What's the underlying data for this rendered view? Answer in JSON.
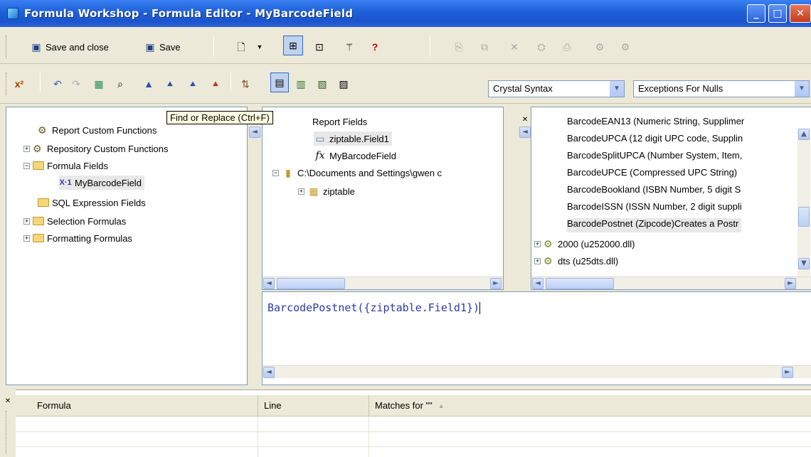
{
  "window": {
    "title": "Formula Workshop - Formula Editor - MyBarcodeField"
  },
  "toolbar1": {
    "save_and_close": "Save and close",
    "save": "Save"
  },
  "toolbar2": {
    "syntax_selected": "Crystal Syntax",
    "nulls_selected": "Exceptions For Nulls"
  },
  "tooltip": "Find or Replace (Ctrl+F)",
  "workshop_tree": {
    "items": [
      {
        "label": "Report Custom Functions"
      },
      {
        "label": "Repository Custom Functions"
      },
      {
        "label": "Formula Fields"
      },
      {
        "label": "MyBarcodeField"
      },
      {
        "label": "SQL Expression Fields"
      },
      {
        "label": "Selection Formulas"
      },
      {
        "label": "Formatting Formulas"
      }
    ]
  },
  "field_tree": {
    "items": [
      {
        "label": "Report Fields"
      },
      {
        "label": "ziptable.Field1"
      },
      {
        "label": "MyBarcodeField"
      },
      {
        "label": "C:\\Documents and Settings\\gwen c"
      },
      {
        "label": "ziptable"
      }
    ]
  },
  "function_tree": {
    "items": [
      {
        "label": "BarcodeEAN13 (Numeric String, Supplimer"
      },
      {
        "label": "BarcodeUPCA (12 digit UPC code, Supplin"
      },
      {
        "label": "BarcodeSplitUPCA (Number System, Item,"
      },
      {
        "label": "BarcodeUPCE (Compressed UPC String)"
      },
      {
        "label": "BarcodeBookland (ISBN Number, 5 digit S"
      },
      {
        "label": "BarcodeISSN (ISSN Number, 2 digit suppli"
      },
      {
        "label": "BarcodePostnet (Zipcode)Creates a Postr"
      },
      {
        "label": "2000 (u252000.dll)"
      },
      {
        "label": "dts (u25dts.dll)"
      }
    ]
  },
  "editor": {
    "text": "BarcodePostnet({ziptable.Field1})"
  },
  "results_grid": {
    "columns": [
      "Formula",
      "Line",
      "Matches for \"\""
    ]
  }
}
